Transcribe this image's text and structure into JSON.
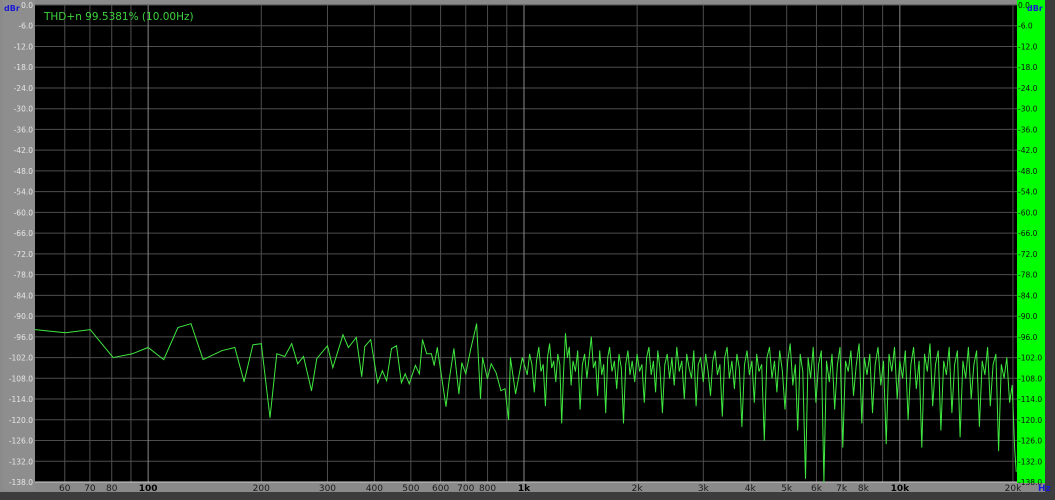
{
  "chart_data": {
    "type": "line",
    "title": "",
    "readout": "THD+n 99.5381% (10.00Hz)",
    "ylabel": "dBr",
    "ylabel_right": "dBr",
    "xlabel": "Hz",
    "x_scale": "log",
    "xlim": [
      50,
      20500
    ],
    "ylim": [
      -138,
      0
    ],
    "grid": true,
    "yticks": [
      "0.0",
      "-6.0",
      "-12.0",
      "-18.0",
      "-24.0",
      "-30.0",
      "-36.0",
      "-42.0",
      "-48.0",
      "-54.0",
      "-60.0",
      "-66.0",
      "-72.0",
      "-78.0",
      "-84.0",
      "-90.0",
      "-96.0",
      "-102.0",
      "-108.0",
      "-114.0",
      "-120.0",
      "-126.0",
      "-132.0",
      "-138.0"
    ],
    "xticks": [
      {
        "value": 60,
        "label": "60"
      },
      {
        "value": 70,
        "label": "70"
      },
      {
        "value": 80,
        "label": "80"
      },
      {
        "value": 90,
        "label": ""
      },
      {
        "value": 100,
        "label": "100",
        "major": true
      },
      {
        "value": 200,
        "label": "200"
      },
      {
        "value": 300,
        "label": "300"
      },
      {
        "value": 400,
        "label": "400"
      },
      {
        "value": 500,
        "label": "500"
      },
      {
        "value": 600,
        "label": "600"
      },
      {
        "value": 700,
        "label": "700"
      },
      {
        "value": 800,
        "label": "800"
      },
      {
        "value": 900,
        "label": ""
      },
      {
        "value": 1000,
        "label": "1k",
        "major": true
      },
      {
        "value": 2000,
        "label": "2k"
      },
      {
        "value": 3000,
        "label": "3k"
      },
      {
        "value": 4000,
        "label": "4k"
      },
      {
        "value": 5000,
        "label": "5k"
      },
      {
        "value": 6000,
        "label": "6k"
      },
      {
        "value": 7000,
        "label": "7k"
      },
      {
        "value": 8000,
        "label": "8k"
      },
      {
        "value": 9000,
        "label": ""
      },
      {
        "value": 10000,
        "label": "10k",
        "major": true
      },
      {
        "value": 20000,
        "label": "20k"
      }
    ],
    "colors": {
      "trace": "#3fe83f",
      "plot_bg": "#000000",
      "grid": "#4e4e4e",
      "grid_major": "#8a8a8a",
      "right_panel": "#00ff00",
      "axis_unit": "#1a1ad6"
    },
    "series": [
      {
        "points": [
          [
            50,
            -93.9
          ],
          [
            60.2,
            -94.8
          ],
          [
            70.1,
            -93.9
          ],
          [
            80.7,
            -102
          ],
          [
            90.7,
            -100.9
          ],
          [
            100,
            -99.1
          ],
          [
            110,
            -102.6
          ],
          [
            120,
            -93.3
          ],
          [
            130,
            -92.2
          ],
          [
            140,
            -102.6
          ],
          [
            157,
            -100
          ],
          [
            170,
            -99.1
          ],
          [
            180,
            -109
          ],
          [
            190,
            -98.3
          ],
          [
            200,
            -98
          ],
          [
            211,
            -119.4
          ],
          [
            220,
            -100.9
          ],
          [
            231,
            -101.7
          ],
          [
            241,
            -98
          ],
          [
            250,
            -103.8
          ],
          [
            259,
            -101.7
          ],
          [
            272,
            -111.6
          ],
          [
            281,
            -102.3
          ],
          [
            300,
            -98.6
          ],
          [
            310,
            -104.9
          ],
          [
            330,
            -95.4
          ],
          [
            341,
            -99.1
          ],
          [
            358,
            -96.2
          ],
          [
            370,
            -107.5
          ],
          [
            377,
            -98.8
          ],
          [
            391,
            -96.8
          ],
          [
            408,
            -109.3
          ],
          [
            420,
            -105.8
          ],
          [
            431,
            -108.7
          ],
          [
            444,
            -99.4
          ],
          [
            458,
            -98.6
          ],
          [
            472,
            -109.3
          ],
          [
            483,
            -106.7
          ],
          [
            495,
            -109.6
          ],
          [
            514,
            -104.3
          ],
          [
            527,
            -106.7
          ],
          [
            537,
            -96.8
          ],
          [
            551,
            -100.9
          ],
          [
            567,
            -100.9
          ],
          [
            577,
            -104.3
          ],
          [
            588,
            -99.1
          ],
          [
            620,
            -116.2
          ],
          [
            632,
            -108.7
          ],
          [
            651,
            -99.4
          ],
          [
            671,
            -112.5
          ],
          [
            683,
            -103.5
          ],
          [
            700,
            -106.7
          ],
          [
            721,
            -99.7
          ],
          [
            748,
            -92.2
          ],
          [
            766,
            -113.9
          ],
          [
            776,
            -102
          ],
          [
            799,
            -108.1
          ],
          [
            818,
            -103.8
          ],
          [
            843,
            -106.4
          ],
          [
            868,
            -111.6
          ],
          [
            890,
            -111
          ],
          [
            910,
            -120
          ],
          [
            920,
            -102
          ],
          [
            950,
            -112.5
          ],
          [
            990,
            -102
          ],
          [
            1020,
            -107
          ],
          [
            1035,
            -101
          ],
          [
            1050,
            -104
          ],
          [
            1065,
            -112
          ],
          [
            1080,
            -103
          ],
          [
            1095,
            -99
          ],
          [
            1110,
            -106
          ],
          [
            1125,
            -104
          ],
          [
            1140,
            -116
          ],
          [
            1155,
            -102
          ],
          [
            1170,
            -98
          ],
          [
            1185,
            -105
          ],
          [
            1200,
            -103
          ],
          [
            1215,
            -109
          ],
          [
            1230,
            -101
          ],
          [
            1245,
            -104
          ],
          [
            1260,
            -121
          ],
          [
            1275,
            -106
          ],
          [
            1290,
            -95
          ],
          [
            1305,
            -102
          ],
          [
            1320,
            -99
          ],
          [
            1335,
            -110
          ],
          [
            1350,
            -103
          ],
          [
            1370,
            -106
          ],
          [
            1390,
            -100
          ],
          [
            1410,
            -117
          ],
          [
            1430,
            -104
          ],
          [
            1450,
            -101
          ],
          [
            1470,
            -108
          ],
          [
            1490,
            -102
          ],
          [
            1510,
            -96
          ],
          [
            1530,
            -105
          ],
          [
            1550,
            -103
          ],
          [
            1570,
            -113
          ],
          [
            1590,
            -100
          ],
          [
            1610,
            -107
          ],
          [
            1630,
            -104
          ],
          [
            1650,
            -118
          ],
          [
            1670,
            -102
          ],
          [
            1690,
            -99
          ],
          [
            1715,
            -106
          ],
          [
            1740,
            -103
          ],
          [
            1765,
            -111
          ],
          [
            1790,
            -101
          ],
          [
            1815,
            -105
          ],
          [
            1840,
            -121
          ],
          [
            1865,
            -104
          ],
          [
            1890,
            -100
          ],
          [
            1915,
            -107
          ],
          [
            1940,
            -103
          ],
          [
            1970,
            -109
          ],
          [
            2000,
            -101
          ],
          [
            2030,
            -106
          ],
          [
            2060,
            -104
          ],
          [
            2090,
            -115
          ],
          [
            2120,
            -102
          ],
          [
            2150,
            -99
          ],
          [
            2180,
            -107
          ],
          [
            2210,
            -103
          ],
          [
            2240,
            -112
          ],
          [
            2270,
            -100
          ],
          [
            2300,
            -105
          ],
          [
            2335,
            -118
          ],
          [
            2370,
            -104
          ],
          [
            2405,
            -101
          ],
          [
            2440,
            -108
          ],
          [
            2475,
            -102
          ],
          [
            2510,
            -110
          ],
          [
            2550,
            -99
          ],
          [
            2590,
            -106
          ],
          [
            2630,
            -103
          ],
          [
            2670,
            -114
          ],
          [
            2710,
            -101
          ],
          [
            2750,
            -105
          ],
          [
            2790,
            -108
          ],
          [
            2830,
            -100
          ],
          [
            2870,
            -116
          ],
          [
            2910,
            -104
          ],
          [
            2950,
            -102
          ],
          [
            3000,
            -109
          ],
          [
            3045,
            -101
          ],
          [
            3090,
            -106
          ],
          [
            3135,
            -113
          ],
          [
            3180,
            -103
          ],
          [
            3225,
            -100
          ],
          [
            3270,
            -107
          ],
          [
            3320,
            -104
          ],
          [
            3370,
            -119
          ],
          [
            3420,
            -102
          ],
          [
            3470,
            -99
          ],
          [
            3520,
            -108
          ],
          [
            3575,
            -103
          ],
          [
            3630,
            -111
          ],
          [
            3685,
            -101
          ],
          [
            3740,
            -105
          ],
          [
            3800,
            -122
          ],
          [
            3860,
            -104
          ],
          [
            3920,
            -100
          ],
          [
            3980,
            -107
          ],
          [
            4040,
            -103
          ],
          [
            4100,
            -115
          ],
          [
            4160,
            -101
          ],
          [
            4220,
            -106
          ],
          [
            4290,
            -104
          ],
          [
            4360,
            -126
          ],
          [
            4430,
            -102
          ],
          [
            4500,
            -99
          ],
          [
            4570,
            -108
          ],
          [
            4640,
            -103
          ],
          [
            4710,
            -112
          ],
          [
            4790,
            -100
          ],
          [
            4870,
            -106
          ],
          [
            4950,
            -117
          ],
          [
            5030,
            -103
          ],
          [
            5110,
            -98
          ],
          [
            5190,
            -110
          ],
          [
            5270,
            -104
          ],
          [
            5350,
            -123
          ],
          [
            5430,
            -101
          ],
          [
            5520,
            -106
          ],
          [
            5610,
            -137
          ],
          [
            5700,
            -102
          ],
          [
            5790,
            -108
          ],
          [
            5880,
            -99
          ],
          [
            5980,
            -115
          ],
          [
            6080,
            -104
          ],
          [
            6180,
            -100
          ],
          [
            6280,
            -138
          ],
          [
            6380,
            -103
          ],
          [
            6490,
            -109
          ],
          [
            6600,
            -101
          ],
          [
            6710,
            -117
          ],
          [
            6820,
            -104
          ],
          [
            6930,
            -99
          ],
          [
            7050,
            -128
          ],
          [
            7170,
            -103
          ],
          [
            7290,
            -106
          ],
          [
            7410,
            -100
          ],
          [
            7530,
            -113
          ],
          [
            7660,
            -104
          ],
          [
            7790,
            -98
          ],
          [
            7920,
            -121
          ],
          [
            8050,
            -102
          ],
          [
            8180,
            -107
          ],
          [
            8320,
            -101
          ],
          [
            8460,
            -118
          ],
          [
            8600,
            -104
          ],
          [
            8750,
            -99
          ],
          [
            8900,
            -110
          ],
          [
            9050,
            -103
          ],
          [
            9200,
            -127
          ],
          [
            9360,
            -101
          ],
          [
            9520,
            -106
          ],
          [
            9680,
            -99
          ],
          [
            9840,
            -114
          ],
          [
            10000,
            -103
          ],
          [
            10170,
            -108
          ],
          [
            10340,
            -100
          ],
          [
            10520,
            -120
          ],
          [
            10700,
            -104
          ],
          [
            10880,
            -99
          ],
          [
            11060,
            -111
          ],
          [
            11250,
            -103
          ],
          [
            11440,
            -128
          ],
          [
            11630,
            -101
          ],
          [
            11830,
            -106
          ],
          [
            12030,
            -98
          ],
          [
            12230,
            -116
          ],
          [
            12440,
            -104
          ],
          [
            12650,
            -100
          ],
          [
            12860,
            -123
          ],
          [
            13080,
            -103
          ],
          [
            13300,
            -107
          ],
          [
            13530,
            -99
          ],
          [
            13760,
            -118
          ],
          [
            13990,
            -104
          ],
          [
            14230,
            -100
          ],
          [
            14470,
            -125
          ],
          [
            14720,
            -103
          ],
          [
            14970,
            -108
          ],
          [
            15220,
            -99
          ],
          [
            15480,
            -114
          ],
          [
            15740,
            -104
          ],
          [
            16010,
            -100
          ],
          [
            16280,
            -122
          ],
          [
            16560,
            -103
          ],
          [
            16840,
            -107
          ],
          [
            17120,
            -99
          ],
          [
            17410,
            -116
          ],
          [
            17710,
            -104
          ],
          [
            18010,
            -101
          ],
          [
            18310,
            -129
          ],
          [
            18620,
            -104
          ],
          [
            18940,
            -108
          ],
          [
            19260,
            -102
          ],
          [
            19590,
            -115
          ],
          [
            19900,
            -110
          ],
          [
            20200,
            -128
          ],
          [
            20400,
            -135
          ]
        ]
      }
    ]
  }
}
